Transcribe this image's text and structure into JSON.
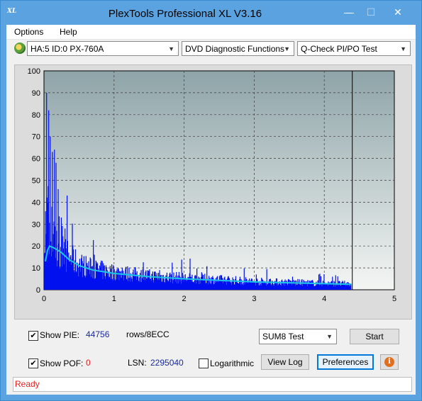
{
  "window": {
    "title": "PlexTools Professional XL V3.16",
    "app_icon_text": "XL"
  },
  "menu": {
    "items": [
      "Options",
      "Help"
    ]
  },
  "toolbar": {
    "drive": "HA:5 ID:0  PX-760A",
    "function": "DVD Diagnostic Functions",
    "test": "Q-Check PI/PO Test"
  },
  "chart_data": {
    "type": "bar",
    "xlim": [
      0,
      5
    ],
    "ylim": [
      0,
      100
    ],
    "x_ticks": [
      "0",
      "1",
      "2",
      "3",
      "4",
      "5"
    ],
    "y_ticks": [
      "0",
      "10",
      "20",
      "30",
      "40",
      "50",
      "60",
      "70",
      "80",
      "90",
      "100"
    ],
    "grid": true,
    "data_end_x": 4.38,
    "end_marker_x": 4.4,
    "colors": {
      "bars": "#0010ee",
      "line": "#19c6e8",
      "bg_top": "#8ea4a8",
      "bg_bottom": "#f4f6f4"
    },
    "peaks": [
      {
        "x": 0.04,
        "y": 90
      },
      {
        "x": 0.07,
        "y": 82
      },
      {
        "x": 0.09,
        "y": 70
      },
      {
        "x": 0.12,
        "y": 63
      },
      {
        "x": 0.15,
        "y": 64
      },
      {
        "x": 0.17,
        "y": 58
      },
      {
        "x": 0.2,
        "y": 46
      },
      {
        "x": 0.25,
        "y": 33
      },
      {
        "x": 0.3,
        "y": 28
      },
      {
        "x": 0.35,
        "y": 17
      },
      {
        "x": 0.4,
        "y": 14
      },
      {
        "x": 0.5,
        "y": 12
      },
      {
        "x": 0.62,
        "y": 11
      },
      {
        "x": 0.72,
        "y": 16
      },
      {
        "x": 1.12,
        "y": 10
      },
      {
        "x": 1.65,
        "y": 9
      },
      {
        "x": 2.25,
        "y": 8
      },
      {
        "x": 2.58,
        "y": 6
      },
      {
        "x": 3.03,
        "y": 7
      },
      {
        "x": 3.23,
        "y": 5
      },
      {
        "x": 3.55,
        "y": 6
      },
      {
        "x": 3.92,
        "y": 7
      },
      {
        "x": 4.12,
        "y": 6
      }
    ],
    "avg_line": [
      [
        0.02,
        13
      ],
      [
        0.05,
        18
      ],
      [
        0.08,
        20
      ],
      [
        0.15,
        19
      ],
      [
        0.25,
        17
      ],
      [
        0.35,
        14
      ],
      [
        0.5,
        11
      ],
      [
        0.7,
        9
      ],
      [
        1.0,
        7.5
      ],
      [
        1.5,
        6
      ],
      [
        2.0,
        5
      ],
      [
        2.5,
        4.3
      ],
      [
        3.0,
        3.6
      ],
      [
        3.5,
        3.2
      ],
      [
        4.0,
        2.8
      ],
      [
        4.38,
        2.5
      ]
    ]
  },
  "controls": {
    "show_pie": {
      "label": "Show PIE:",
      "checked": true,
      "value": "44756",
      "unit": "rows/8ECC"
    },
    "show_poe": {
      "label": "Show POF:",
      "checked": true,
      "value": "0"
    },
    "lsn": {
      "label": "LSN:",
      "value": "2295040"
    },
    "logarithmic": {
      "label": "Logarithmic",
      "checked": false
    },
    "sum_select": "SUM8 Test",
    "start_button": "Start",
    "view_log_button": "View Log",
    "preferences_button": "Preferences",
    "info_button": "i"
  },
  "status": {
    "text": "Ready"
  }
}
